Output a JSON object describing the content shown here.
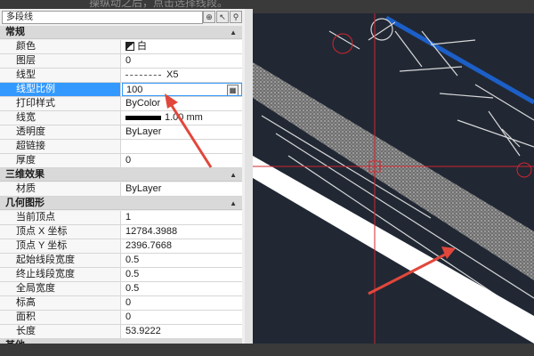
{
  "caption": "操纵动之后，点击选择线段。",
  "selector": {
    "value": "多段线"
  },
  "sections": {
    "general": "常规",
    "effects3d": "三维效果",
    "geometry": "几何图形",
    "other": "其他"
  },
  "general_rows": [
    {
      "name": "颜色",
      "value": "白"
    },
    {
      "name": "图层",
      "value": "0"
    },
    {
      "name": "线型",
      "value": "X5"
    },
    {
      "name": "线型比例",
      "value": "100"
    },
    {
      "name": "打印样式",
      "value": "ByColor"
    },
    {
      "name": "线宽",
      "value": "1.00 mm"
    },
    {
      "name": "透明度",
      "value": "ByLayer"
    },
    {
      "name": "超链接",
      "value": ""
    },
    {
      "name": "厚度",
      "value": "0"
    }
  ],
  "effects_rows": [
    {
      "name": "材质",
      "value": "ByLayer"
    }
  ],
  "geometry_rows": [
    {
      "name": "当前顶点",
      "value": "1"
    },
    {
      "name": "顶点 X 坐标",
      "value": "12784.3988"
    },
    {
      "name": "顶点 Y 坐标",
      "value": "2396.7668"
    },
    {
      "name": "起始线段宽度",
      "value": "0.5"
    },
    {
      "name": "终止线段宽度",
      "value": "0.5"
    },
    {
      "name": "全局宽度",
      "value": "0.5"
    },
    {
      "name": "标高",
      "value": "0"
    },
    {
      "name": "面积",
      "value": "0"
    },
    {
      "name": "长度",
      "value": "53.9222"
    }
  ],
  "colors": {
    "accent": "#3399ff",
    "canvas_bg": "#212834",
    "arrow": "#e2473b"
  }
}
